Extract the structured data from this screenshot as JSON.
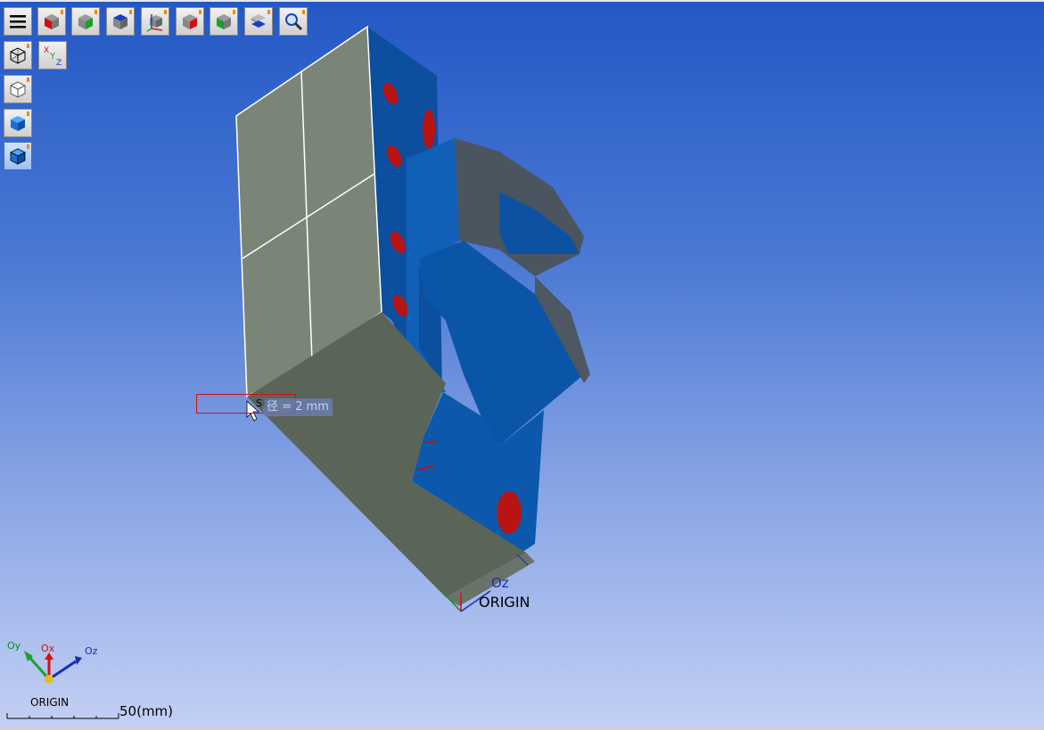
{
  "toolbar": {
    "top_buttons": [
      {
        "name": "menu-button",
        "icon": "hamburger-icon"
      },
      {
        "name": "view-front-button",
        "icon": "cube-red-face-icon"
      },
      {
        "name": "view-back-button",
        "icon": "cube-green-face-icon"
      },
      {
        "name": "view-top-button",
        "icon": "cube-blue-face-icon"
      },
      {
        "name": "view-axes-button",
        "icon": "axes-cube-icon"
      },
      {
        "name": "view-right-button",
        "icon": "cube-red-right-icon"
      },
      {
        "name": "view-left-button",
        "icon": "cube-green-left-icon"
      },
      {
        "name": "view-bottom-button",
        "icon": "cube-blue-bottom-icon"
      },
      {
        "name": "zoom-fit-button",
        "icon": "magnifier-icon"
      }
    ],
    "side_buttons": [
      {
        "name": "wireframe-button",
        "icon": "wire-cube-icon"
      },
      {
        "name": "hidden-line-button",
        "icon": "outline-cube-icon"
      },
      {
        "name": "shaded-button",
        "icon": "blue-cube-icon"
      },
      {
        "name": "shaded-edges-button",
        "icon": "blue-cube-edges-icon",
        "active": true
      }
    ],
    "axis_toggle_label": {
      "x": "X",
      "y": "Y",
      "z": "Z"
    }
  },
  "viewport": {
    "model_origin_label": "ORIGIN",
    "model_axis_label": "Oz",
    "tooltip_text": "径 = 2 mm",
    "hint_text": "SE",
    "colors": {
      "face_gray": "#7a8578",
      "face_dark": "#5b6459",
      "face_blue": "#0a55a8",
      "hole_red": "#b81414"
    }
  },
  "triad": {
    "origin_label": "ORIGIN",
    "ox": "Ox",
    "oy": "Oy",
    "oz": "Oz"
  },
  "scale_bar": {
    "label": "50(mm)"
  }
}
